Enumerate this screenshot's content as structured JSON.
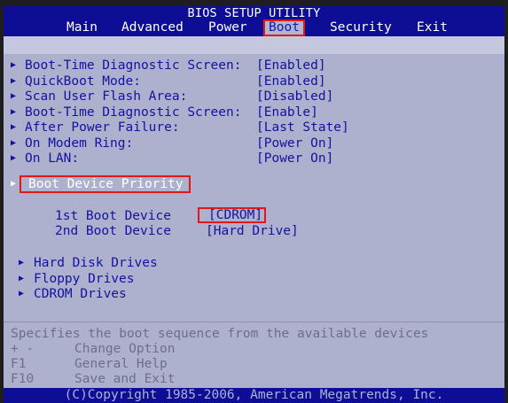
{
  "header": {
    "title": "BIOS SETUP UTILITY",
    "tabs": [
      {
        "label": "Main",
        "active": false
      },
      {
        "label": "Advanced",
        "active": false
      },
      {
        "label": "Power",
        "active": false
      },
      {
        "label": "Boot",
        "active": true
      },
      {
        "label": "Security",
        "active": false
      },
      {
        "label": "Exit",
        "active": false
      }
    ]
  },
  "settings": [
    {
      "label": "Boot-Time Diagnostic Screen:",
      "value": "[Enabled]"
    },
    {
      "label": "QuickBoot Mode:",
      "value": "[Enabled]"
    },
    {
      "label": "Scan User Flash Area:",
      "value": "[Disabled]"
    },
    {
      "label": "Boot-Time Diagnostic Screen:",
      "value": "[Enable]"
    },
    {
      "label": "After Power Failure:",
      "value": "[Last State]"
    },
    {
      "label": "On Modem Ring:",
      "value": "[Power On]"
    },
    {
      "label": "On LAN:",
      "value": "[Power On]"
    }
  ],
  "boot_device_priority": {
    "label": "Boot Device Priority",
    "devices": [
      {
        "label": "1st Boot Device",
        "value": "[CDROM]"
      },
      {
        "label": "2nd Boot Device",
        "value": "[Hard Drive]"
      }
    ]
  },
  "submenus": [
    {
      "label": "Hard Disk Drives"
    },
    {
      "label": "Floppy Drives"
    },
    {
      "label": "CDROM Drives"
    }
  ],
  "help": {
    "description": "Specifies the boot sequence from the available devices",
    "keys": [
      {
        "key": "+ -",
        "action": "Change Option"
      },
      {
        "key": "F1",
        "action": "General Help"
      },
      {
        "key": "F10",
        "action": "Save and Exit"
      }
    ]
  },
  "footer": {
    "copyright": "(C)Copyright 1985-2006, American Megatrends, Inc."
  },
  "icons": {
    "arrow": "right-triangle-icon"
  },
  "colors": {
    "header_bg": "#0d0d96",
    "panel_bg": "#aeb1cd",
    "text": "#1212a0",
    "highlight_border": "#e01818"
  }
}
